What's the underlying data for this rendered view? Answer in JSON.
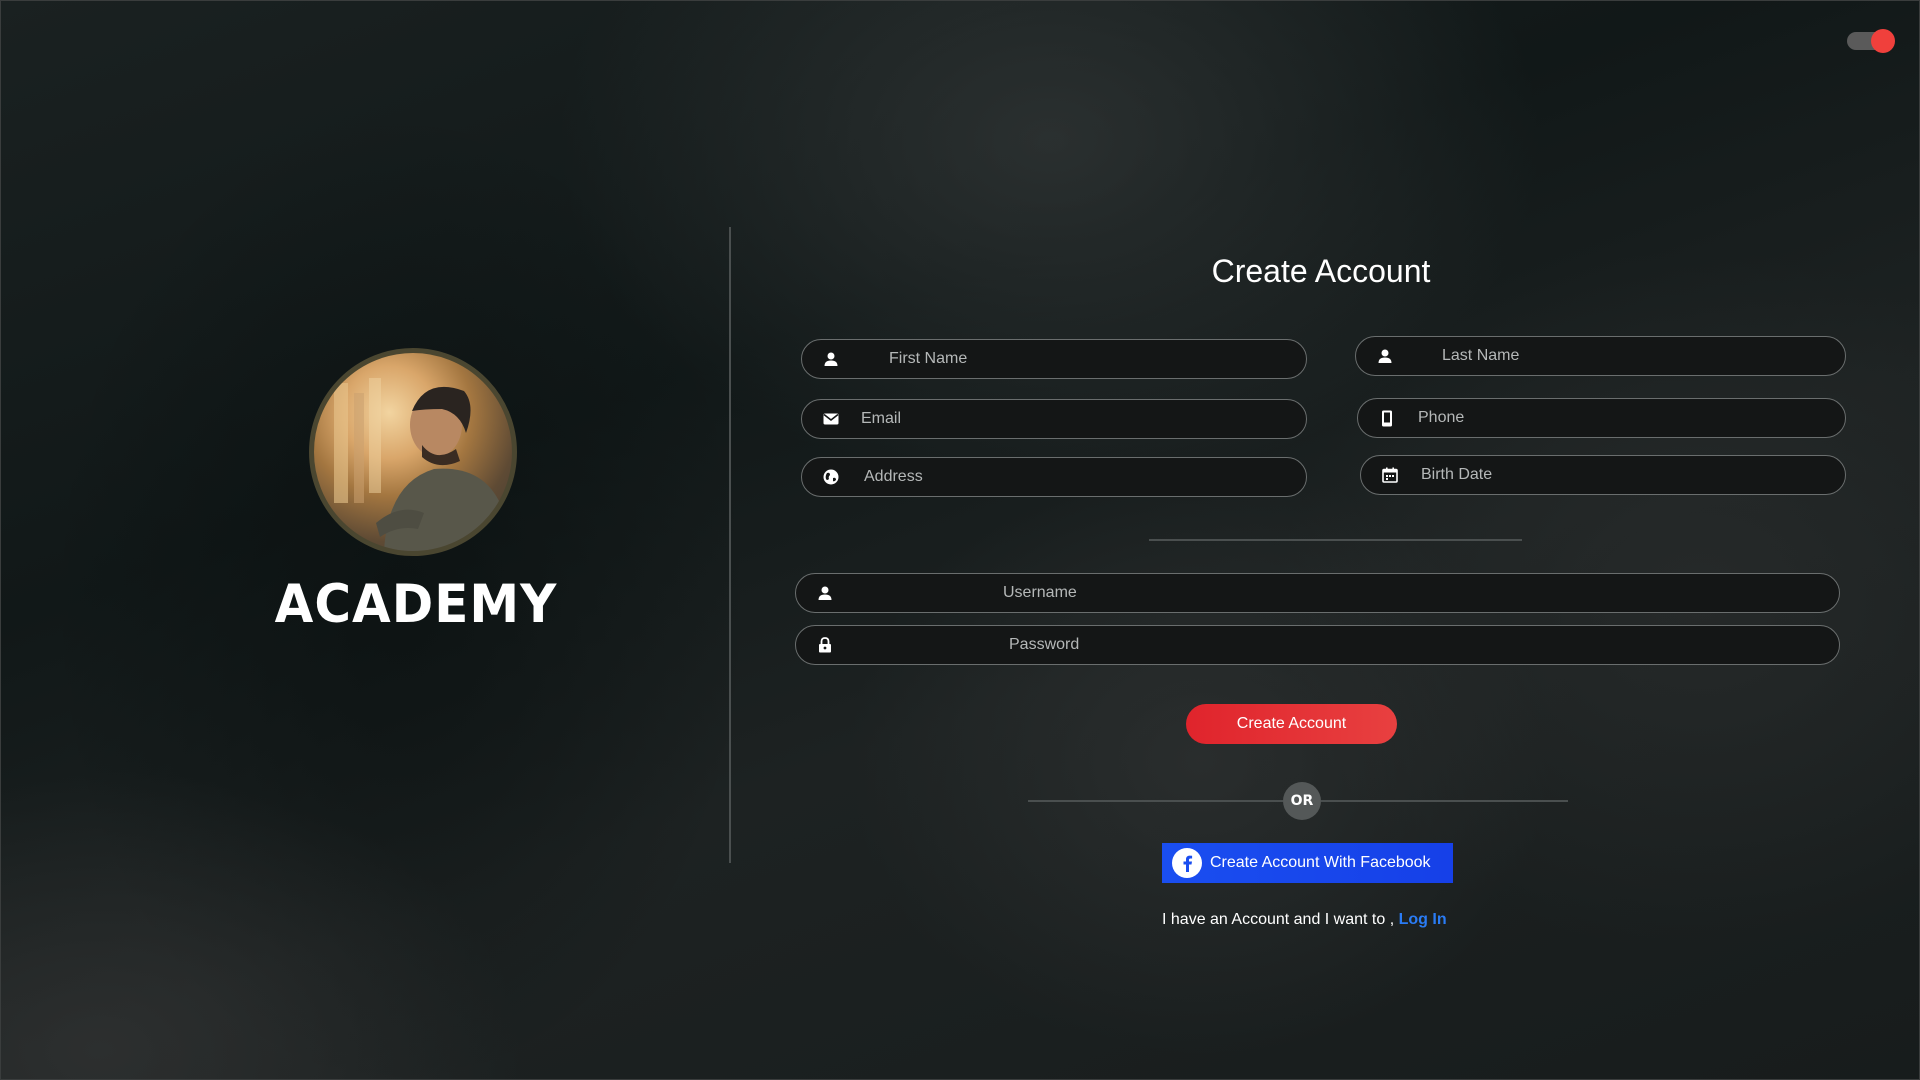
{
  "brand": {
    "name": "ACADEMY",
    "avatar_icon": "profile-photo"
  },
  "theme_toggle": {
    "icon": "toggle-switch",
    "state": "on",
    "color": "#f0403c"
  },
  "form": {
    "title": "Create Account",
    "fields": {
      "first_name": {
        "placeholder": "First Name",
        "icon": "user-icon"
      },
      "last_name": {
        "placeholder": "Last Name",
        "icon": "user-icon"
      },
      "email": {
        "placeholder": "Email",
        "icon": "mail-icon"
      },
      "phone": {
        "placeholder": "Phone",
        "icon": "phone-icon"
      },
      "address": {
        "placeholder": "Address",
        "icon": "globe-icon"
      },
      "birth_date": {
        "placeholder": "Birth Date",
        "icon": "calendar-icon"
      },
      "username": {
        "placeholder": "Username",
        "icon": "user-icon"
      },
      "password": {
        "placeholder": "Password",
        "icon": "lock-icon"
      }
    },
    "submit_label": "Create Account",
    "or_label": "OR",
    "facebook_label": "Create Account With Facebook",
    "login_prompt": "I have an Account and I want to ,",
    "login_link": "Log In"
  },
  "colors": {
    "accent_red": "#e0242c",
    "facebook_blue": "#1a4ef0",
    "link_blue": "#2a7cf5"
  }
}
